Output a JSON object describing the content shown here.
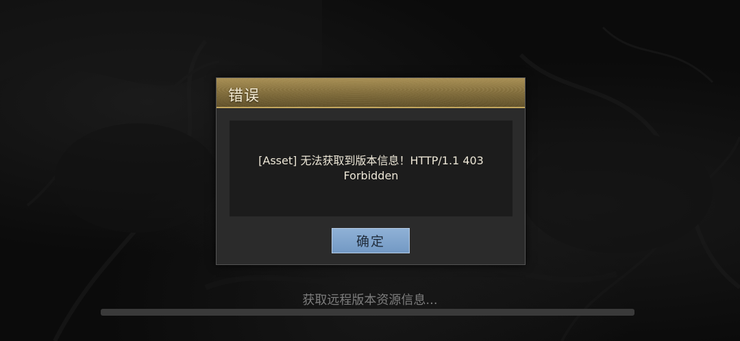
{
  "dialog": {
    "title": "错误",
    "message": "[Asset] 无法获取到版本信息！HTTP/1.1 403 Forbidden",
    "ok_label": "确定"
  },
  "loading": {
    "status_text": "获取远程版本资源信息...",
    "progress": 0
  },
  "colors": {
    "header_gold": "#8c7643",
    "button_blue": "#7fa4cd",
    "panel_dark": "#1c1c1c"
  }
}
